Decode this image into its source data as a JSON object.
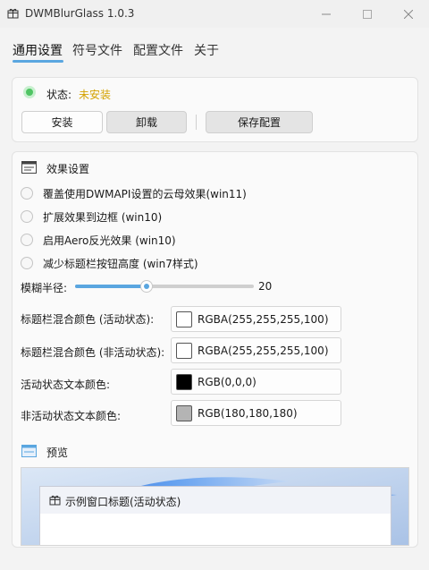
{
  "window": {
    "title": "DWMBlurGlass 1.0.3"
  },
  "tabs": [
    {
      "label": "通用设置"
    },
    {
      "label": "符号文件"
    },
    {
      "label": "配置文件"
    },
    {
      "label": "关于"
    }
  ],
  "status": {
    "label": "状态:",
    "value": "未安装"
  },
  "buttons": {
    "install": "安装",
    "uninstall": "卸载",
    "save": "保存配置"
  },
  "effects": {
    "title": "效果设置",
    "options": [
      {
        "label": "覆盖使用DWMAPI设置的云母效果(win11)",
        "checked": false
      },
      {
        "label": "扩展效果到边框 (win10)",
        "checked": false
      },
      {
        "label": "启用Aero反光效果 (win10)",
        "checked": false
      },
      {
        "label": "减少标题栏按钮高度 (win7样式)",
        "checked": false
      }
    ],
    "blur": {
      "label": "模糊半径:",
      "value": "20",
      "fraction": 0.4
    },
    "colors": [
      {
        "label": "标题栏混合颜色 (活动状态):",
        "value": "RGBA(255,255,255,100)",
        "swatch": "#ffffff"
      },
      {
        "label": "标题栏混合颜色 (非活动状态):",
        "value": "RGBA(255,255,255,100)",
        "swatch": "#ffffff"
      },
      {
        "label": "活动状态文本颜色:",
        "value": "RGB(0,0,0)",
        "swatch": "#000000"
      },
      {
        "label": "非活动状态文本颜色:",
        "value": "RGB(180,180,180)",
        "swatch": "#b4b4b4"
      }
    ]
  },
  "preview": {
    "title": "预览",
    "window_title": "示例窗口标题(活动状态)"
  },
  "colors": {
    "accent": "#5aa6e0",
    "status_ok": "#4fc463",
    "status_warning": "#d4a200"
  },
  "icons": {
    "app": "gift-icon",
    "effects": "window-settings-icon",
    "preview": "preview-window-icon"
  }
}
